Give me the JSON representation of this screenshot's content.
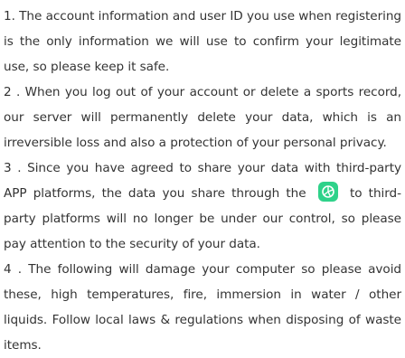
{
  "items": [
    {
      "text": "1. The account information and user ID you use when registering is the only information we will use to confirm your legitimate use, so please keep it safe."
    },
    {
      "text": "2 . When you log out of your account or delete a sports record, our server will permanently delete your data, which is an irreversible loss and also a protection of your personal privacy."
    },
    {
      "before": "3 . Since you have agreed to share your data with third-party APP platforms, the data you share through the",
      "icon": "share-app-icon",
      "after": "to third-party platforms will no longer be under our control, so please pay attention to the security of your data."
    },
    {
      "text": "4 . The following will damage your computer so please avoid these, high temperatures, fire, immersion in water / other liquids. Follow local laws & regulations when disposing of waste items."
    }
  ],
  "colors": {
    "text": "#333333",
    "icon_bg": "#2fd28a",
    "icon_fg": "#ffffff"
  }
}
